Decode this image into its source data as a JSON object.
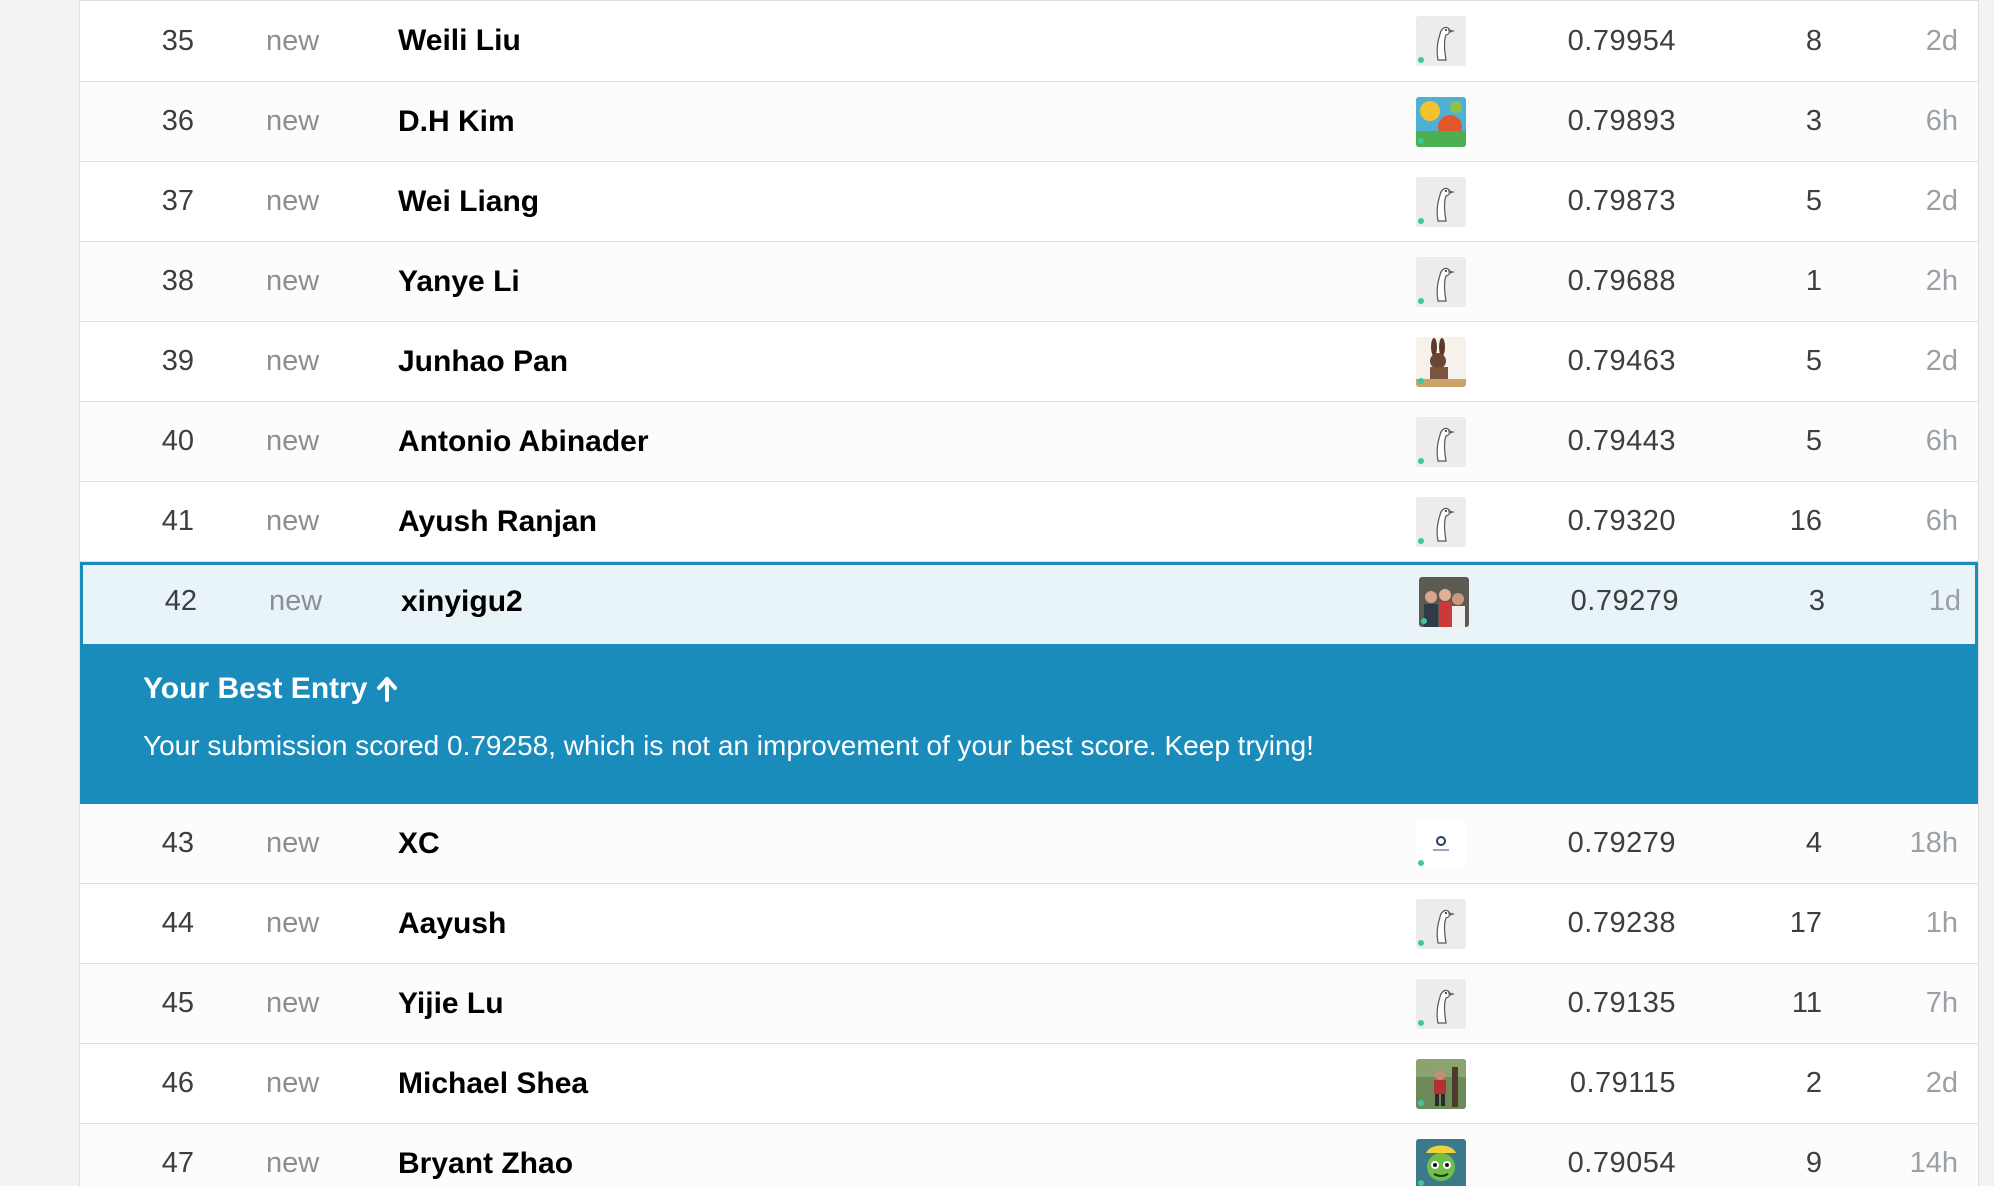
{
  "colors": {
    "accent": "#1a8cbc",
    "highlight_row_bg": "#e8f4f8",
    "online_dot": "#3ec8a0",
    "page_bg": "#f1f3f4"
  },
  "rows_before": [
    {
      "rank": "35",
      "delta": "new",
      "team": "Weili Liu",
      "avatar": "goose-default-avatar",
      "score": "0.79954",
      "entries": "8",
      "last": "2d"
    },
    {
      "rank": "36",
      "delta": "new",
      "team": "D.H Kim",
      "avatar": "colorful-painting-avatar",
      "score": "0.79893",
      "entries": "3",
      "last": "6h"
    },
    {
      "rank": "37",
      "delta": "new",
      "team": "Wei Liang",
      "avatar": "goose-default-avatar",
      "score": "0.79873",
      "entries": "5",
      "last": "2d"
    },
    {
      "rank": "38",
      "delta": "new",
      "team": "Yanye Li",
      "avatar": "goose-default-avatar",
      "score": "0.79688",
      "entries": "1",
      "last": "2h"
    },
    {
      "rank": "39",
      "delta": "new",
      "team": "Junhao Pan",
      "avatar": "cartoon-bunny-avatar",
      "score": "0.79463",
      "entries": "5",
      "last": "2d"
    },
    {
      "rank": "40",
      "delta": "new",
      "team": "Antonio Abinader",
      "avatar": "goose-default-avatar",
      "score": "0.79443",
      "entries": "5",
      "last": "6h"
    },
    {
      "rank": "41",
      "delta": "new",
      "team": "Ayush Ranjan",
      "avatar": "goose-default-avatar",
      "score": "0.79320",
      "entries": "16",
      "last": "6h"
    }
  ],
  "my_row": {
    "rank": "42",
    "delta": "new",
    "team": "xinyigu2",
    "avatar": "group-photo-avatar",
    "score": "0.79279",
    "entries": "3",
    "last": "1d"
  },
  "banner": {
    "title": "Your Best Entry",
    "message": "Your submission scored 0.79258, which is not an improvement of your best score. Keep trying!"
  },
  "rows_after": [
    {
      "rank": "43",
      "delta": "new",
      "team": "XC",
      "avatar": "small-logo-avatar",
      "score": "0.79279",
      "entries": "4",
      "last": "18h"
    },
    {
      "rank": "44",
      "delta": "new",
      "team": "Aayush",
      "avatar": "goose-default-avatar",
      "score": "0.79238",
      "entries": "17",
      "last": "1h"
    },
    {
      "rank": "45",
      "delta": "new",
      "team": "Yijie Lu",
      "avatar": "goose-default-avatar",
      "score": "0.79135",
      "entries": "11",
      "last": "7h"
    },
    {
      "rank": "46",
      "delta": "new",
      "team": "Michael Shea",
      "avatar": "outdoor-photo-avatar",
      "score": "0.79115",
      "entries": "2",
      "last": "2d"
    },
    {
      "rank": "47",
      "delta": "new",
      "team": "Bryant Zhao",
      "avatar": "green-cartoon-avatar",
      "score": "0.79054",
      "entries": "9",
      "last": "14h"
    }
  ]
}
